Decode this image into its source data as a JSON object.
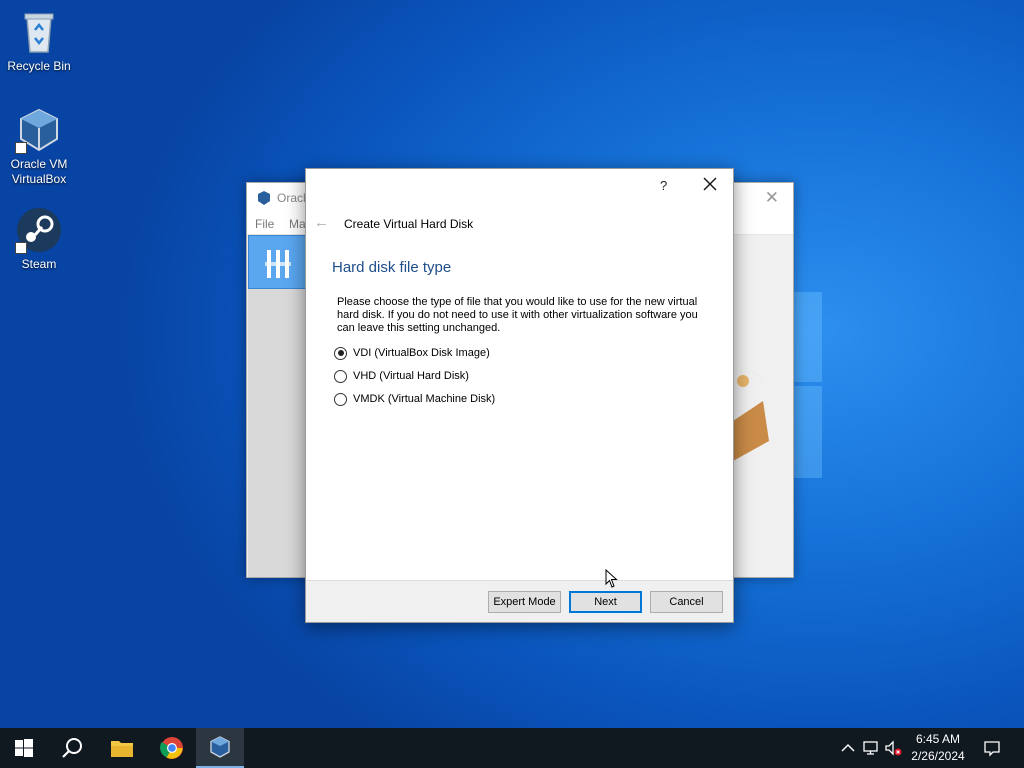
{
  "desktop": {
    "icons": [
      {
        "label": "Recycle Bin"
      },
      {
        "label": "Oracle VM VirtualBox"
      },
      {
        "label": "Steam"
      }
    ]
  },
  "background_window": {
    "title": "Oracle",
    "menu": [
      "File",
      "Ma"
    ]
  },
  "dialog": {
    "help_glyph": "?",
    "title": "Create Virtual Hard Disk",
    "heading": "Hard disk file type",
    "description": "Please choose the type of file that you would like to use for the new virtual hard disk. If you do not need to use it with other virtualization software you can leave this setting unchanged.",
    "options": [
      {
        "label": "VDI (VirtualBox Disk Image)",
        "checked": true
      },
      {
        "label": "VHD (Virtual Hard Disk)",
        "checked": false
      },
      {
        "label": "VMDK (Virtual Machine Disk)",
        "checked": false
      }
    ],
    "buttons": {
      "expert": "Expert Mode",
      "next": "Next",
      "cancel": "Cancel"
    }
  },
  "taskbar": {
    "items": [
      "start-icon",
      "search-icon",
      "file-explorer-icon",
      "chrome-icon",
      "virtualbox-icon"
    ],
    "time": "6:45 AM",
    "date": "2/26/2024"
  },
  "colors": {
    "accent": "#0078d7",
    "heading": "#1f4e8c",
    "taskbar": "#101820"
  }
}
